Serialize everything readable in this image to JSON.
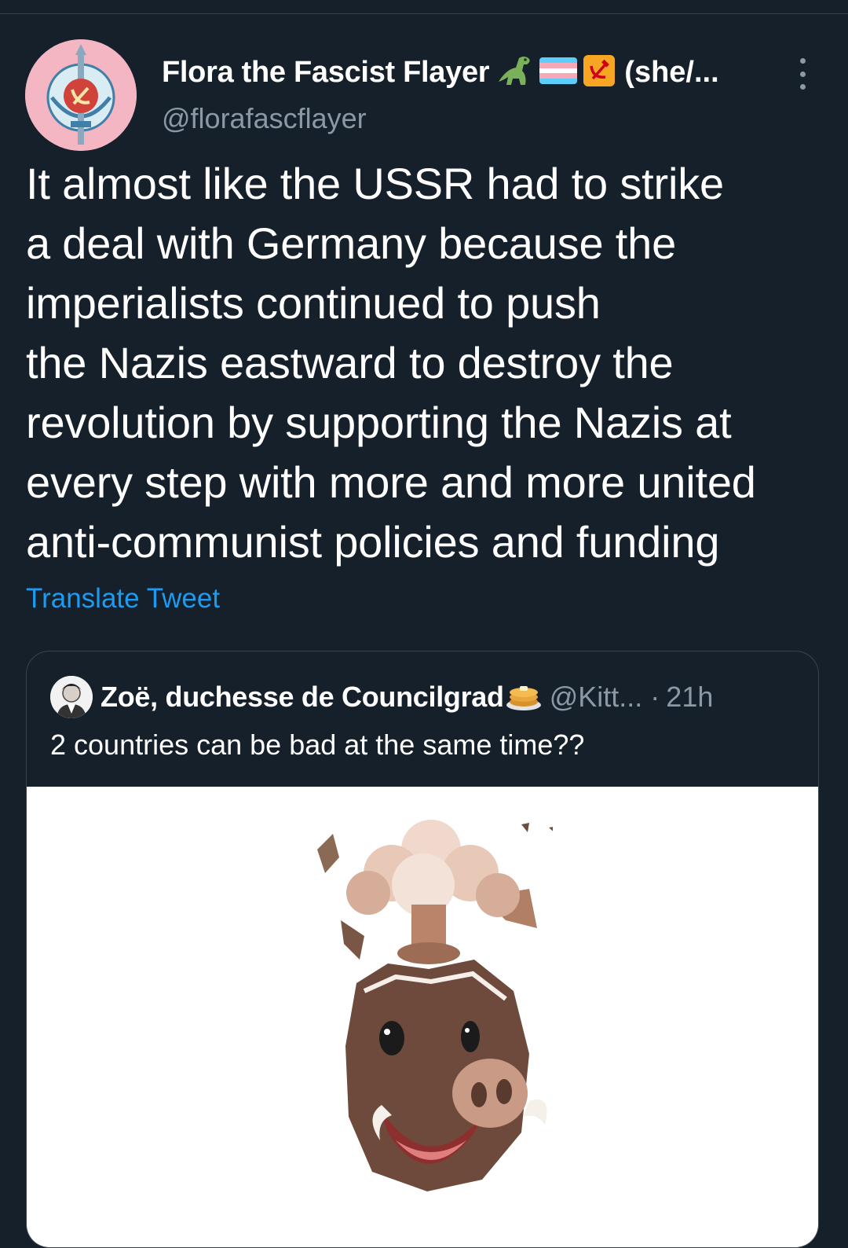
{
  "tweet": {
    "author": {
      "display_name": "Flora the Fascist Flayer",
      "pronouns": "(she/...",
      "handle": "@florafascflayer",
      "name_emojis": [
        "t-rex-emoji",
        "transgender-flag-emoji",
        "hammer-and-sickle-emoji"
      ]
    },
    "text": "It almost like the USSR had to strike\na deal with Germany because the\nimperialists continued to push\nthe Nazis eastward to destroy the\nrevolution by supporting the Nazis at\nevery step with more and more united\nanti-communist policies and funding",
    "translate_label": "Translate Tweet",
    "more_icon": "more-vertical-icon"
  },
  "quoted_tweet": {
    "display_name": "Zoë, duchesse de Councilgrad",
    "name_emoji": "pancakes-emoji",
    "handle": "@Kitt...",
    "separator": "·",
    "time": "21h",
    "text": "2 countries can be bad at the same time??",
    "media": "exploding-head-boar-animoji"
  },
  "colors": {
    "background": "#15202b",
    "text_primary": "#ffffff",
    "text_secondary": "#8b98a5",
    "link": "#1d9bf0",
    "border": "#38444d",
    "avatar_bg": "#f4b6c2"
  }
}
